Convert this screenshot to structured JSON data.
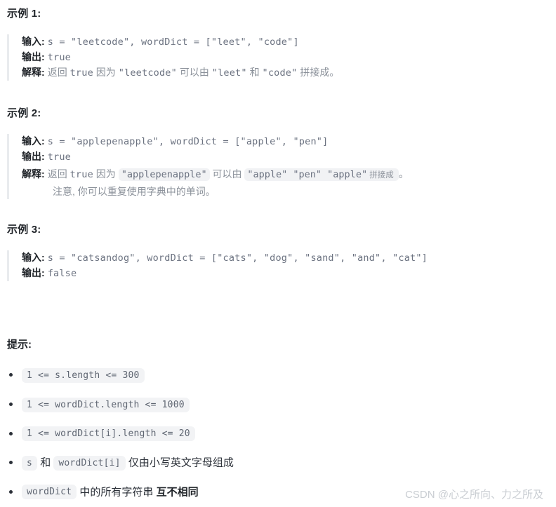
{
  "examples": [
    {
      "heading": "示例 1:",
      "input_label": "输入:",
      "input_value": "s = \"leetcode\", wordDict = [\"leet\", \"code\"]",
      "output_label": "输出:",
      "output_value": "true",
      "explain_label": "解释:",
      "explain_parts": [
        {
          "type": "cn",
          "text": "返回 "
        },
        {
          "type": "code",
          "text": "true"
        },
        {
          "type": "cn",
          "text": " 因为 "
        },
        {
          "type": "code",
          "text": "\"leetcode\""
        },
        {
          "type": "cn",
          "text": " 可以由 "
        },
        {
          "type": "code",
          "text": "\"leet\""
        },
        {
          "type": "cn",
          "text": " 和 "
        },
        {
          "type": "code",
          "text": "\"code\""
        },
        {
          "type": "cn",
          "text": " 拼接成。"
        }
      ],
      "explain_line2": ""
    },
    {
      "heading": "示例 2:",
      "input_label": "输入:",
      "input_value": "s = \"applepenapple\", wordDict = [\"apple\", \"pen\"]",
      "output_label": "输出:",
      "output_value": "true",
      "explain_label": "解释:",
      "explain_parts": [
        {
          "type": "cn",
          "text": "返回 "
        },
        {
          "type": "code",
          "text": "true"
        },
        {
          "type": "cn",
          "text": " 因为 "
        },
        {
          "type": "chip",
          "text": "\"applepenapple\""
        },
        {
          "type": "cn",
          "text": " 可以由 "
        },
        {
          "type": "chip",
          "text": "\"apple\" \"pen\" \"apple\""
        },
        {
          "type": "chip-cn",
          "text": "拼接成"
        },
        {
          "type": "cn",
          "text": "。"
        }
      ],
      "explain_line2": "注意, 你可以重复使用字典中的单词。"
    },
    {
      "heading": "示例 3:",
      "input_label": "输入:",
      "input_value": "s = \"catsandog\", wordDict = [\"cats\", \"dog\", \"sand\", \"and\", \"cat\"]",
      "output_label": "输出:",
      "output_value": "false",
      "explain_label": "",
      "explain_parts": [],
      "explain_line2": ""
    }
  ],
  "hints": {
    "heading": "提示:",
    "items": [
      {
        "parts": [
          {
            "type": "code",
            "text": "1 <= s.length <= 300"
          }
        ]
      },
      {
        "parts": [
          {
            "type": "code",
            "text": "1 <= wordDict.length <= 1000"
          }
        ]
      },
      {
        "parts": [
          {
            "type": "code",
            "text": "1 <= wordDict[i].length <= 20"
          }
        ]
      },
      {
        "parts": [
          {
            "type": "code",
            "text": "s"
          },
          {
            "type": "cn",
            "text": " 和 "
          },
          {
            "type": "code",
            "text": "wordDict[i]"
          },
          {
            "type": "cn",
            "text": " 仅由小写英文字母组成"
          }
        ]
      },
      {
        "parts": [
          {
            "type": "code",
            "text": "wordDict"
          },
          {
            "type": "cn",
            "text": " 中的所有字符串 "
          },
          {
            "type": "strong",
            "text": "互不相同"
          }
        ]
      }
    ]
  },
  "watermark": {
    "text": "CSDN @心之所向、力之所及"
  },
  "colors": {
    "background": "#ffffff",
    "text": "#24292f",
    "heading": "#1f2328",
    "code": "#6b7280",
    "explain": "#8a9099",
    "chip_bg": "#f2f3f5",
    "quote_border": "#e9ebee",
    "watermark": "#c9cdd2"
  }
}
